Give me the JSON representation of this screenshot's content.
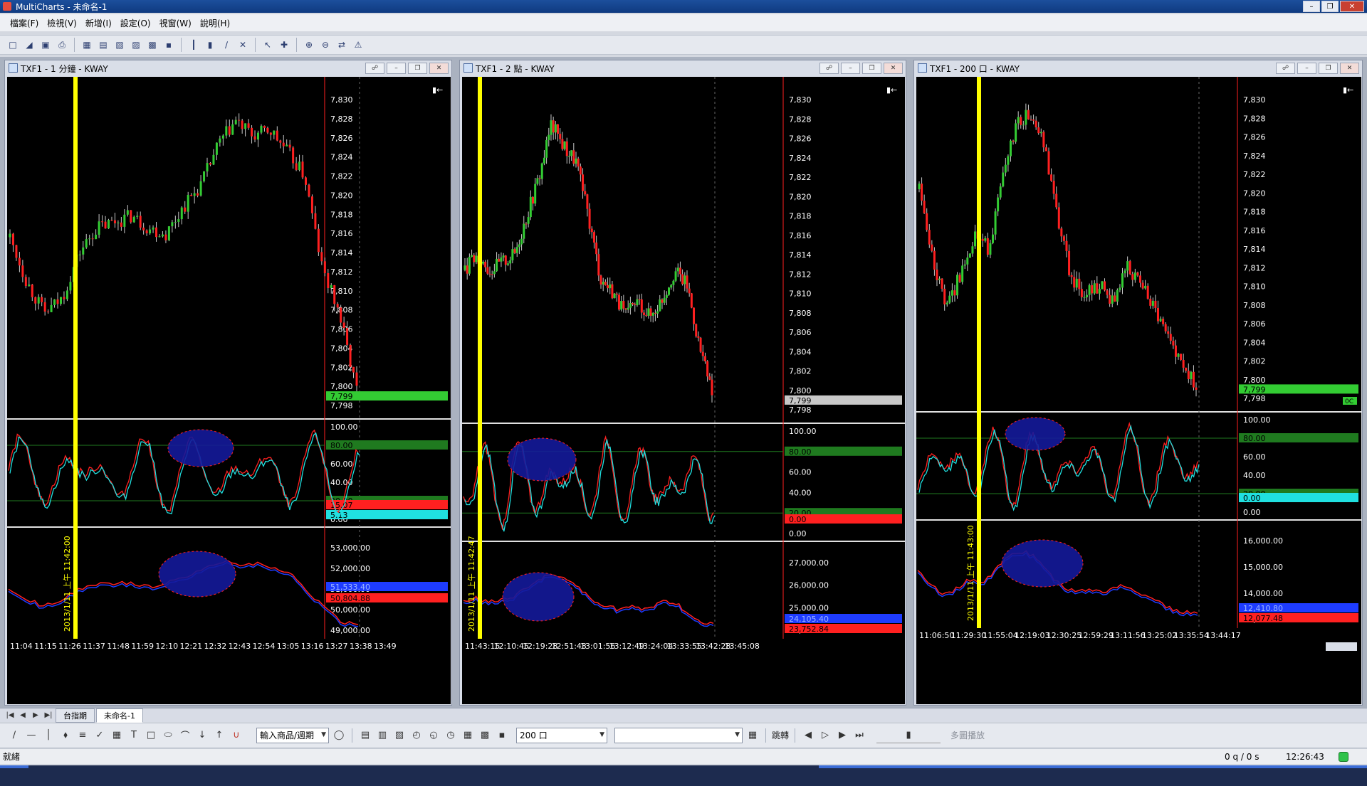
{
  "app": {
    "title": "MultiCharts - 未命名-1"
  },
  "menu": [
    "檔案(F)",
    "檢視(V)",
    "新增(I)",
    "設定(O)",
    "視窗(W)",
    "說明(H)"
  ],
  "toolbar_icons": [
    "new-icon",
    "open-icon",
    "save-icon",
    "print-icon",
    "chart-window-icon",
    "scanner-icon",
    "dom-icon",
    "portfolio-icon",
    "order-icon",
    "quote-icon",
    "bar-chart-icon",
    "candle-icon",
    "line-icon",
    "point-figure-icon",
    "cursor-icon",
    "crosshair-icon",
    "zoom-in-icon",
    "zoom-out-icon",
    "scroll-icon",
    "alert-icon"
  ],
  "window_controls": [
    "minimize-icon",
    "restore-icon",
    "close-icon"
  ],
  "colors": {
    "background": "#000000",
    "up": "#33cc33",
    "down": "#ff2020",
    "marker": "#ffff00",
    "ellipse_fill": "#141a9a",
    "ellipse_stroke": "#ff2020",
    "blue_line": "#1e3cff",
    "cyan_line": "#20e0e0",
    "price_axis": "#ff2020",
    "level_line": "#1f7a1f"
  },
  "charts": [
    {
      "title": "TXF1 - 1 分鐘 - KWAY",
      "price_ticks": [
        "7,830",
        "7,828",
        "7,826",
        "7,824",
        "7,822",
        "7,820",
        "7,818",
        "7,816",
        "7,814",
        "7,812",
        "7,810",
        "7,808",
        "7,806",
        "7,804",
        "7,802",
        "7,800",
        "7,798"
      ],
      "price_marker": {
        "text": "7,799",
        "color": "#33cc33"
      },
      "osc_ticks": [
        "100.00",
        "80.00",
        "60.00",
        "40.00",
        "20.00",
        "0.00"
      ],
      "osc_badges": [
        {
          "text": "80.00",
          "color": "#1f7a1f"
        },
        {
          "text": "20.00",
          "color": "#1f7a1f"
        },
        {
          "text": "15.07",
          "color": "#ff2020"
        },
        {
          "text": "5.13",
          "color": "#20e0e0"
        }
      ],
      "vol_ticks": [
        "53,000.00",
        "52,000.00",
        "51,000.00",
        "50,000.00",
        "49,000.00"
      ],
      "vol_badges": [
        {
          "text": "51,533.40",
          "color": "#1e3cff"
        },
        {
          "text": "50,804.88",
          "color": "#ff2020"
        }
      ],
      "time_ticks": [
        "11:04",
        "11:15",
        "11:26",
        "11:37",
        "11:48",
        "11:59",
        "12:10",
        "12:21",
        "12:32",
        "12:43",
        "12:54",
        "13:05",
        "13:16",
        "13:27",
        "13:38",
        "13:49"
      ],
      "marker_label": "2013/1/11 上午 11:42:00"
    },
    {
      "title": "TXF1 - 2 點 - KWAY",
      "price_ticks": [
        "7,830",
        "7,828",
        "7,826",
        "7,824",
        "7,822",
        "7,820",
        "7,818",
        "7,816",
        "7,814",
        "7,812",
        "7,810",
        "7,808",
        "7,806",
        "7,804",
        "7,802",
        "7,800",
        "7,798"
      ],
      "price_marker": {
        "text": "7,799",
        "color": "#c8c8c8"
      },
      "osc_ticks": [
        "100.00",
        "80.00",
        "60.00",
        "40.00",
        "20.00",
        "0.00"
      ],
      "osc_badges": [
        {
          "text": "80.00",
          "color": "#1f7a1f"
        },
        {
          "text": "20.00",
          "color": "#1f7a1f"
        },
        {
          "text": "0.00",
          "color": "#ff2020"
        }
      ],
      "vol_ticks": [
        "27,000.00",
        "26,000.00",
        "25,000.00",
        "24,000.00"
      ],
      "vol_badges": [
        {
          "text": "24,105.40",
          "color": "#1e3cff"
        },
        {
          "text": "23,752.84",
          "color": "#ff2020"
        }
      ],
      "time_ticks": [
        "11:43:15",
        "12:10:45",
        "12:19:28",
        "12:51:43",
        "13:01:56",
        "13:12:49",
        "13:24:04",
        "13:33:55",
        "13:42:28",
        "13:45:08"
      ],
      "marker_label": "2013/1/11 上午 11:42:47"
    },
    {
      "title": "TXF1 - 200 口 - KWAY",
      "price_ticks": [
        "7,830",
        "7,828",
        "7,826",
        "7,824",
        "7,822",
        "7,820",
        "7,818",
        "7,816",
        "7,814",
        "7,812",
        "7,810",
        "7,808",
        "7,806",
        "7,804",
        "7,802",
        "7,800",
        "7,798"
      ],
      "price_marker": {
        "text": "7,799",
        "color": "#33cc33"
      },
      "price_extra": "0C",
      "osc_ticks": [
        "100.00",
        "80.00",
        "60.00",
        "40.00",
        "20.00",
        "0.00"
      ],
      "osc_badges": [
        {
          "text": "80.00",
          "color": "#1f7a1f"
        },
        {
          "text": "20.00",
          "color": "#1f7a1f"
        },
        {
          "text": "0.00",
          "color": "#20e0e0"
        }
      ],
      "vol_ticks": [
        "16,000.00",
        "15,000.00",
        "14,000.00",
        "13,000.00"
      ],
      "vol_badges": [
        {
          "text": "12,410.80",
          "color": "#1e3cff"
        },
        {
          "text": "12,077.48",
          "color": "#ff2020"
        }
      ],
      "time_ticks": [
        "11:06:50",
        "11:29:30",
        "11:55:04",
        "12:19:03",
        "12:30:25",
        "12:59:29",
        "13:11:56",
        "13:25:02",
        "13:35:54",
        "13:44:17"
      ],
      "marker_label": "2013/1/11 上午 11:43:00"
    }
  ],
  "tabs": [
    "台指期",
    "未命名-1"
  ],
  "drawbar": {
    "symbol_combo": "輸入商品/週期",
    "resolution_combo": "200 口",
    "link_label": "跳轉",
    "playback_label": "多圖播放"
  },
  "status": {
    "text": "就緒",
    "orders": "0 q / 0 s",
    "time": "12:26:43"
  }
}
